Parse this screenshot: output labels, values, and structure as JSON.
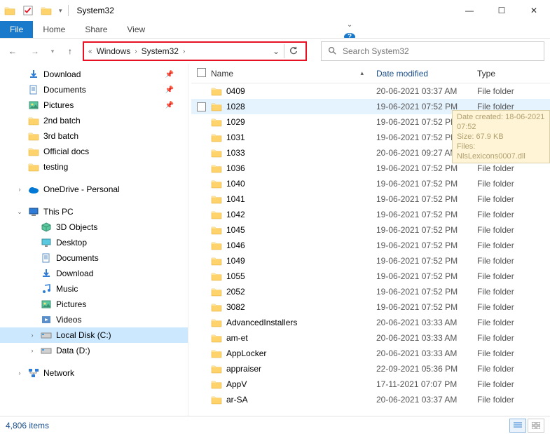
{
  "window": {
    "title": "System32"
  },
  "ribbon": {
    "file": "File",
    "tabs": [
      "Home",
      "Share",
      "View"
    ]
  },
  "breadcrumb": {
    "parts": [
      "Windows",
      "System32"
    ]
  },
  "search": {
    "placeholder": "Search System32"
  },
  "sidebar": {
    "quick": [
      {
        "label": "Download",
        "icon": "download",
        "pinned": true
      },
      {
        "label": "Documents",
        "icon": "documents",
        "pinned": true
      },
      {
        "label": "Pictures",
        "icon": "pictures",
        "pinned": true
      },
      {
        "label": "2nd batch",
        "icon": "folder",
        "pinned": false
      },
      {
        "label": "3rd batch",
        "icon": "folder",
        "pinned": false
      },
      {
        "label": "Official docs",
        "icon": "folder",
        "pinned": false
      },
      {
        "label": "testing",
        "icon": "folder",
        "pinned": false
      }
    ],
    "onedrive": {
      "label": "OneDrive - Personal"
    },
    "thispc": {
      "label": "This PC",
      "children": [
        {
          "label": "3D Objects",
          "icon": "3d"
        },
        {
          "label": "Desktop",
          "icon": "desktop"
        },
        {
          "label": "Documents",
          "icon": "documents"
        },
        {
          "label": "Download",
          "icon": "download"
        },
        {
          "label": "Music",
          "icon": "music"
        },
        {
          "label": "Pictures",
          "icon": "pictures"
        },
        {
          "label": "Videos",
          "icon": "videos"
        },
        {
          "label": "Local Disk (C:)",
          "icon": "disk",
          "selected": true
        },
        {
          "label": "Data (D:)",
          "icon": "disk"
        }
      ]
    },
    "network": {
      "label": "Network"
    }
  },
  "columns": {
    "name": "Name",
    "date": "Date modified",
    "type": "Type"
  },
  "type_folder": "File folder",
  "files": [
    {
      "name": "0409",
      "date": "20-06-2021 03:37 AM"
    },
    {
      "name": "1028",
      "date": "19-06-2021 07:52 PM",
      "hovered": true
    },
    {
      "name": "1029",
      "date": "19-06-2021 07:52 PM"
    },
    {
      "name": "1031",
      "date": "19-06-2021 07:52 PM"
    },
    {
      "name": "1033",
      "date": "20-06-2021 09:27 AM"
    },
    {
      "name": "1036",
      "date": "19-06-2021 07:52 PM"
    },
    {
      "name": "1040",
      "date": "19-06-2021 07:52 PM"
    },
    {
      "name": "1041",
      "date": "19-06-2021 07:52 PM"
    },
    {
      "name": "1042",
      "date": "19-06-2021 07:52 PM"
    },
    {
      "name": "1045",
      "date": "19-06-2021 07:52 PM"
    },
    {
      "name": "1046",
      "date": "19-06-2021 07:52 PM"
    },
    {
      "name": "1049",
      "date": "19-06-2021 07:52 PM"
    },
    {
      "name": "1055",
      "date": "19-06-2021 07:52 PM"
    },
    {
      "name": "2052",
      "date": "19-06-2021 07:52 PM"
    },
    {
      "name": "3082",
      "date": "19-06-2021 07:52 PM"
    },
    {
      "name": "AdvancedInstallers",
      "date": "20-06-2021 03:33 AM"
    },
    {
      "name": "am-et",
      "date": "20-06-2021 03:33 AM"
    },
    {
      "name": "AppLocker",
      "date": "20-06-2021 03:33 AM"
    },
    {
      "name": "appraiser",
      "date": "22-09-2021 05:36 PM"
    },
    {
      "name": "AppV",
      "date": "17-11-2021 07:07 PM"
    },
    {
      "name": "ar-SA",
      "date": "20-06-2021 03:37 AM"
    }
  ],
  "tooltip": {
    "line1": "Date created: 18-06-2021 07:52",
    "line2": "Size: 67.9 KB",
    "line3": "Files: NlsLexicons0007.dll"
  },
  "status": {
    "count": "4,806 items"
  }
}
